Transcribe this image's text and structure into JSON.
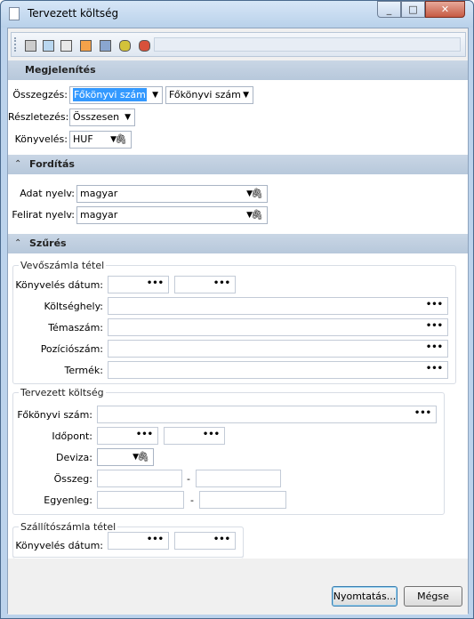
{
  "window": {
    "title": "Tervezett költség",
    "minimize_icon": "minimize-icon",
    "maximize_icon": "maximize-icon",
    "close_icon": "close-icon",
    "min_glyph": "_",
    "max_glyph": "□",
    "close_glyph": "✕"
  },
  "toolbar": {
    "buttons": [
      {
        "name": "print-icon"
      },
      {
        "name": "print-preview-icon"
      },
      {
        "name": "copy-icon"
      },
      {
        "name": "edit-icon"
      },
      {
        "name": "calculator-icon"
      },
      {
        "name": "database-icon"
      },
      {
        "name": "export-icon"
      }
    ]
  },
  "megjelenites": {
    "title": "Megjelenítés",
    "osszegzes_label": "Összegzés:",
    "osszegzes_value1": "Főkönyvi szám",
    "osszegzes_value2": "Főkönyvi szám",
    "reszletezes_label": "Részletezés:",
    "reszletezes_value": "Összesen",
    "konyveles_label": "Könyvelés:",
    "konyveles_value": "HUF"
  },
  "forditas": {
    "title": "Fordítás",
    "adat_nyelv_label": "Adat nyelv:",
    "adat_nyelv_value": "magyar",
    "felirat_nyelv_label": "Felirat nyelv:",
    "felirat_nyelv_value": "magyar"
  },
  "szures": {
    "title": "Szűrés",
    "vevoszamla": {
      "title": "Vevőszámla tétel",
      "konyveles_datum_label": "Könyvelés dátum:",
      "koltseghely_label": "Költséghely:",
      "temaszam_label": "Témaszám:",
      "pozicioszam_label": "Pozíciószám:",
      "termek_label": "Termék:"
    },
    "tervezett": {
      "title": "Tervezett költség",
      "fokonyvi_label": "Főkönyvi szám:",
      "idopont_label": "Időpont:",
      "deviza_label": "Deviza:",
      "osszeg_label": "Összeg:",
      "egyenleg_label": "Egyenleg:",
      "range_dash": "-"
    },
    "szallitoszamla": {
      "title": "Szállítószámla tétel",
      "konyveles_datum_label": "Könyvelés dátum:"
    }
  },
  "glyphs": {
    "dropdown": "▼",
    "attach": "🖇",
    "ellipsis": "•••",
    "collapse": "⌃"
  },
  "buttons": {
    "print": "Nyomtatás...",
    "cancel": "Mégse"
  }
}
